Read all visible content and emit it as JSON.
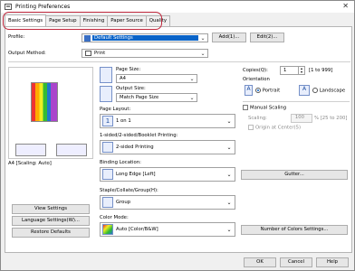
{
  "window": {
    "title": "Printing Preferences",
    "close_glyph": "✕"
  },
  "tabs": [
    {
      "label": "Basic Settings",
      "active": true
    },
    {
      "label": "Page Setup"
    },
    {
      "label": "Finishing"
    },
    {
      "label": "Paper Source"
    },
    {
      "label": "Quality"
    }
  ],
  "profile": {
    "label": "Profile:",
    "value": "Default Settings",
    "add_label": "Add(1)...",
    "edit_label": "Edit(2)..."
  },
  "output_method": {
    "label": "Output Method:",
    "value": "Print"
  },
  "preview": {
    "caption": "A4 [Scaling: Auto]"
  },
  "left_buttons": {
    "view_settings": "View Settings",
    "language_settings": "Language Settings(W)...",
    "restore_defaults": "Restore Defaults"
  },
  "page_size": {
    "label": "Page Size:",
    "value": "A4"
  },
  "output_size": {
    "label": "Output Size:",
    "value": "Match Page Size"
  },
  "page_layout": {
    "label": "Page Layout:",
    "icon_text": "1",
    "value": "1 on 1"
  },
  "printing_mode": {
    "label": "1-sided/2-sided/Booklet Printing:",
    "value": "2-sided Printing"
  },
  "binding": {
    "label": "Binding Location:",
    "value": "Long Edge [Left]",
    "gutter_label": "Gutter..."
  },
  "staple": {
    "label": "Staple/Collate/Group(H):",
    "value": "Group"
  },
  "color_mode": {
    "label": "Color Mode:",
    "value": "Auto [Color/B&W]",
    "colors_label": "Number of Colors Settings..."
  },
  "copies": {
    "label": "Copies(Q):",
    "value": "1",
    "range": "[1 to 999]"
  },
  "orientation": {
    "label": "Orientation",
    "portrait": "Portrait",
    "landscape": "Landscape",
    "selected": "Portrait"
  },
  "scaling": {
    "manual_label": "Manual Scaling",
    "scaling_label": "Scaling:",
    "value": "100",
    "range": "% [25 to 200]",
    "origin_label": "Origin at Center(5)"
  },
  "footer": {
    "ok": "OK",
    "cancel": "Cancel",
    "help": "Help"
  }
}
